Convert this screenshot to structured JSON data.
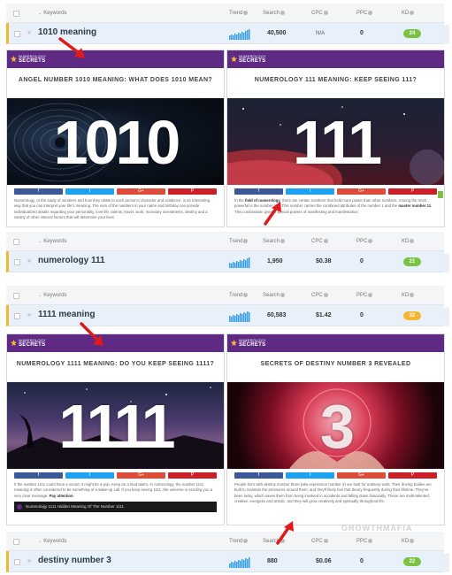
{
  "columns": {
    "keywords": "Keywords",
    "trend": "Trend",
    "search": "Search",
    "cpc": "CPC",
    "ppc": "PPC",
    "kd": "KD"
  },
  "rows": [
    {
      "keyword": "1010 meaning",
      "search": "40,500",
      "cpc": "N/A",
      "ppc": "0",
      "kd": "24",
      "kd_color": "#7cc242"
    },
    {
      "keyword": "numerology 111",
      "search": "1,950",
      "cpc": "$0.38",
      "ppc": "0",
      "kd": "21",
      "kd_color": "#7cc242"
    },
    {
      "keyword": "1111 meaning",
      "search": "60,583",
      "cpc": "$1.42",
      "ppc": "0",
      "kd": "32",
      "kd_color": "#f5b731"
    },
    {
      "keyword": "destiny number 3",
      "search": "880",
      "cpc": "$0.06",
      "ppc": "0",
      "kd": "22",
      "kd_color": "#7cc242"
    }
  ],
  "brand": {
    "line1": "NUMEROLOGY",
    "line2": "SECRETS",
    "bar_color": "#5f2a83"
  },
  "panels": [
    {
      "title": "ANGEL NUMBER 1010 MEANING: WHAT DOES 1010 MEAN?",
      "hero_number": "1010",
      "body": "Numerology, or the study of numbers and how they relate to each person's character and existence, is an interesting way that you can interpret your life's meaning. The sum of the numbers in your name and birthday can provide individualized details regarding your personality, love life, talents, travel, work, monetary investments, destiny and a variety of other interest factors that will determine your lives"
    },
    {
      "title": "NUMEROLOGY 111 MEANING: KEEP SEEING 111?",
      "hero_number": "111",
      "body_pre": "In the ",
      "body_b1": "field of numerology",
      "body_mid": ", there are certain numbers that hold more power than other numbers. Among the most powerful is the number 111. This number carries the combined attributes of the number 1 and the ",
      "body_b2": "master number 11",
      "body_post": ". This combination gives it special powers of manifesting and manifestation."
    },
    {
      "title": "NUMEROLOGY 1111 MEANING: DO YOU KEEP SEEING 1111?",
      "hero_number": "1111",
      "body_main": "If the number 1111 could have a sound, it might be a pop. Keep an a loud alarm. In numerology, the number 1111 meaning is often considered to be something of a wake-up call. If you keep seeing 1111, the universe is sending you a very clear message: ",
      "body_em": "Pay attention",
      "body_end": ".",
      "video_title": "Numerology 1111 Hidden Meaning Of The Number 1111"
    },
    {
      "title": "SECRETS OF DESTINY NUMBER 3 REVEALED",
      "hero_number": "3",
      "body": "People born with destiny number three (aka expression number 3) are built for ordinary work. Their driving bodies are built to maintain the pressures around them, and they'll likely feel that theory frequently during their lifetime. They've been lucky, which saves them from being involved in accidents and falling down financially. These are multi-talented, creative, energetic and artistic, and they will grow creatively and spiritually throughout life."
    }
  ],
  "share_colors": {
    "facebook": "#3b5998",
    "twitter": "#1da1f2",
    "google": "#dd4b39",
    "pinterest": "#cb2027"
  },
  "share_labels": {
    "facebook": "f",
    "twitter": "t",
    "google": "G+",
    "pinterest": "P"
  },
  "watermark": "GROWTHMAFIA"
}
